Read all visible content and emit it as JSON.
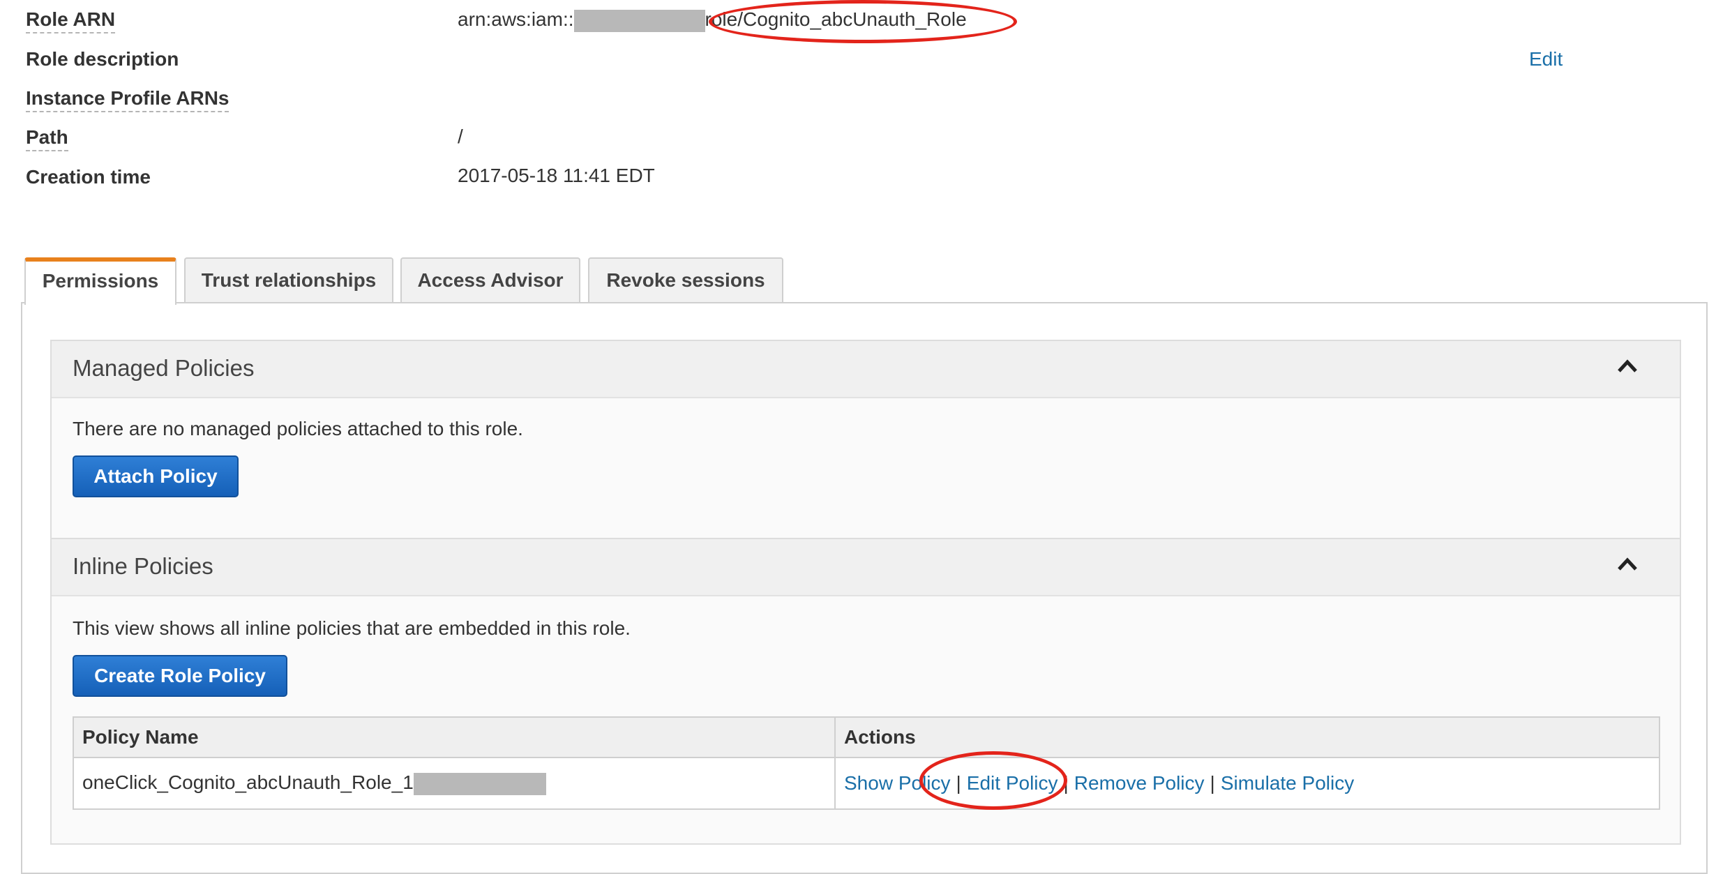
{
  "summary": {
    "role_arn_label": "Role ARN",
    "role_arn_prefix": "arn:aws:iam::",
    "role_arn_suffix": "role/Cognito_abcUnauth_Role",
    "role_description_label": "Role description",
    "edit_link": "Edit",
    "instance_profile_label": "Instance Profile ARNs",
    "path_label": "Path",
    "path_value": "/",
    "creation_time_label": "Creation time",
    "creation_time_value": "2017-05-18 11:41 EDT"
  },
  "tabs": [
    {
      "label": "Permissions",
      "active": true
    },
    {
      "label": "Trust relationships",
      "active": false
    },
    {
      "label": "Access Advisor",
      "active": false
    },
    {
      "label": "Revoke sessions",
      "active": false
    }
  ],
  "managed_policies": {
    "title": "Managed Policies",
    "description": "There are no managed policies attached to this role.",
    "button": "Attach Policy"
  },
  "inline_policies": {
    "title": "Inline Policies",
    "description": "This view shows all inline policies that are embedded in this role.",
    "button": "Create Role Policy",
    "columns": [
      "Policy Name",
      "Actions"
    ],
    "rows": [
      {
        "name_prefix": "oneClick_Cognito_abcUnauth_Role_1",
        "actions": [
          "Show Policy",
          "Edit Policy",
          "Remove Policy",
          "Simulate Policy"
        ]
      }
    ]
  },
  "colors": {
    "link": "#1a6fa8",
    "active_tab_accent": "#e8811d",
    "button": "#1f6fc5",
    "annotation": "#e3241b"
  }
}
